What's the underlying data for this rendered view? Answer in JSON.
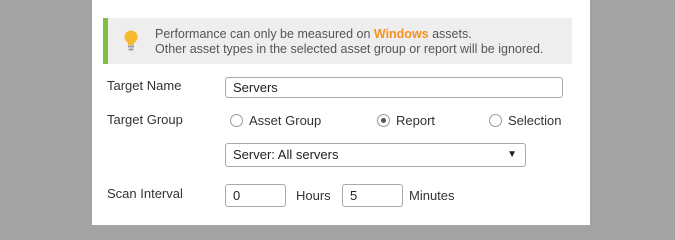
{
  "notice": {
    "prefix": "Performance can only be measured on ",
    "highlight": "Windows",
    "suffix": " assets.",
    "line2": "Other asset types in the selected asset group or report will be ignored."
  },
  "form": {
    "target_name": {
      "label": "Target Name",
      "value": "Servers"
    },
    "target_group": {
      "label": "Target Group",
      "options": [
        {
          "label": "Asset Group",
          "selected": false
        },
        {
          "label": "Report",
          "selected": true
        },
        {
          "label": "Selection",
          "selected": false
        }
      ],
      "select_value": "Server: All servers"
    },
    "scan_interval": {
      "label": "Scan Interval",
      "hours_value": "0",
      "hours_unit": "Hours",
      "minutes_value": "5",
      "minutes_unit": "Minutes"
    }
  },
  "icons": {
    "notice": "lightbulb-icon",
    "dropdown": "caret-down-icon"
  },
  "colors": {
    "accent_bar": "#7fbf3f",
    "highlight": "#f39221",
    "bulb": "#f5b82e"
  }
}
